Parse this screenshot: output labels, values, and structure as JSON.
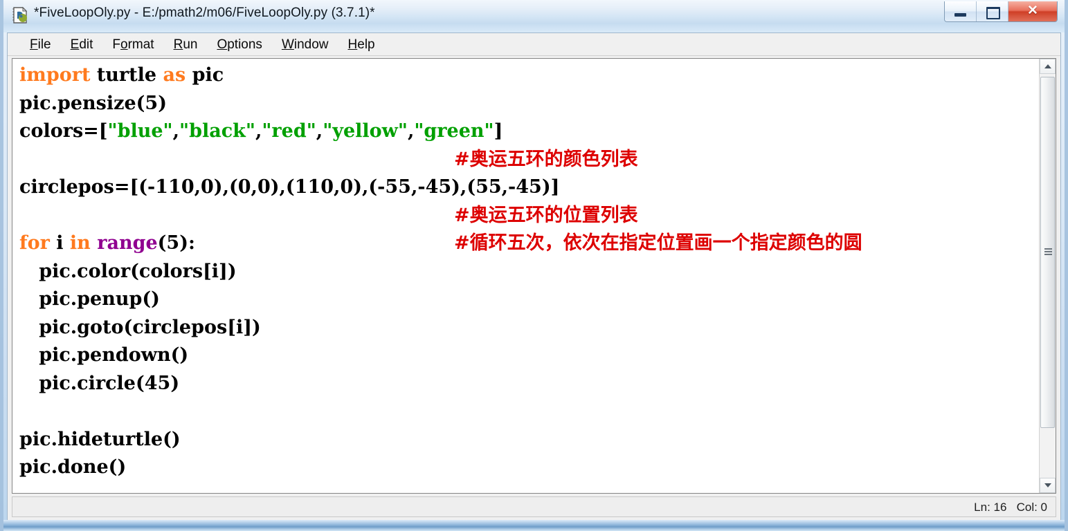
{
  "window": {
    "title": "*FiveLoopOly.py - E:/pmath2/m06/FiveLoopOly.py (3.7.1)*",
    "icon": "python-file-icon",
    "controls": {
      "minimize_label": "",
      "maximize_label": "",
      "close_label": "✕"
    }
  },
  "menubar": {
    "items": [
      {
        "label": "File",
        "accel": "F"
      },
      {
        "label": "Edit",
        "accel": "E"
      },
      {
        "label": "Format",
        "accel": "o"
      },
      {
        "label": "Run",
        "accel": "R"
      },
      {
        "label": "Options",
        "accel": "O"
      },
      {
        "label": "Window",
        "accel": "W"
      },
      {
        "label": "Help",
        "accel": "H"
      }
    ]
  },
  "editor": {
    "lines": [
      {
        "segments": [
          {
            "text": "import",
            "type": "keyword"
          },
          {
            "text": " turtle ",
            "type": "plain"
          },
          {
            "text": "as",
            "type": "keyword"
          },
          {
            "text": " pic",
            "type": "plain"
          }
        ]
      },
      {
        "segments": [
          {
            "text": "pic.pensize(5)",
            "type": "plain"
          }
        ]
      },
      {
        "segments": [
          {
            "text": "colors=[",
            "type": "plain"
          },
          {
            "text": "\"blue\"",
            "type": "string"
          },
          {
            "text": ",",
            "type": "plain"
          },
          {
            "text": "\"black\"",
            "type": "string"
          },
          {
            "text": ",",
            "type": "plain"
          },
          {
            "text": "\"red\"",
            "type": "string"
          },
          {
            "text": ",",
            "type": "plain"
          },
          {
            "text": "\"yellow\"",
            "type": "string"
          },
          {
            "text": ",",
            "type": "plain"
          },
          {
            "text": "\"green\"",
            "type": "string"
          },
          {
            "text": "]",
            "type": "plain"
          }
        ]
      },
      {
        "segments": [],
        "comment": "#奥运五环的颜色列表"
      },
      {
        "segments": [
          {
            "text": "circlepos=[(-110,0),(0,0),(110,0),(-55,-45),(55,-45)]",
            "type": "plain"
          }
        ]
      },
      {
        "segments": [],
        "comment": "#奥运五环的位置列表"
      },
      {
        "segments": [
          {
            "text": "for",
            "type": "keyword"
          },
          {
            "text": " i ",
            "type": "plain"
          },
          {
            "text": "in",
            "type": "keyword"
          },
          {
            "text": " ",
            "type": "plain"
          },
          {
            "text": "range",
            "type": "builtin"
          },
          {
            "text": "(5):",
            "type": "plain"
          }
        ],
        "comment": "#循环五次，依次在指定位置画一个指定颜色的圆"
      },
      {
        "segments": [
          {
            "text": "   pic.color(colors[i])",
            "type": "plain"
          }
        ]
      },
      {
        "segments": [
          {
            "text": "   pic.penup()",
            "type": "plain"
          }
        ]
      },
      {
        "segments": [
          {
            "text": "   pic.goto(circlepos[i])",
            "type": "plain"
          }
        ]
      },
      {
        "segments": [
          {
            "text": "   pic.pendown()",
            "type": "plain"
          }
        ]
      },
      {
        "segments": [
          {
            "text": "   pic.circle(45)",
            "type": "plain"
          }
        ]
      },
      {
        "segments": [
          {
            "text": "",
            "type": "plain"
          }
        ]
      },
      {
        "segments": [
          {
            "text": "pic.hideturtle()",
            "type": "plain"
          }
        ]
      },
      {
        "segments": [
          {
            "text": "pic.done()",
            "type": "plain"
          }
        ]
      }
    ],
    "syntax_colors": {
      "keyword": "#ff7a1e",
      "builtin": "#900090",
      "string": "#00a000",
      "comment": "#dd0000",
      "plain": "#000000",
      "background": "#ffffff"
    }
  },
  "scrollbar": {
    "up_arrow": "chevron-up-icon",
    "down_arrow": "chevron-down-icon",
    "thumb_grip": "grip-icon"
  },
  "statusbar": {
    "position_text": "Ln: 16   Col: 0"
  }
}
